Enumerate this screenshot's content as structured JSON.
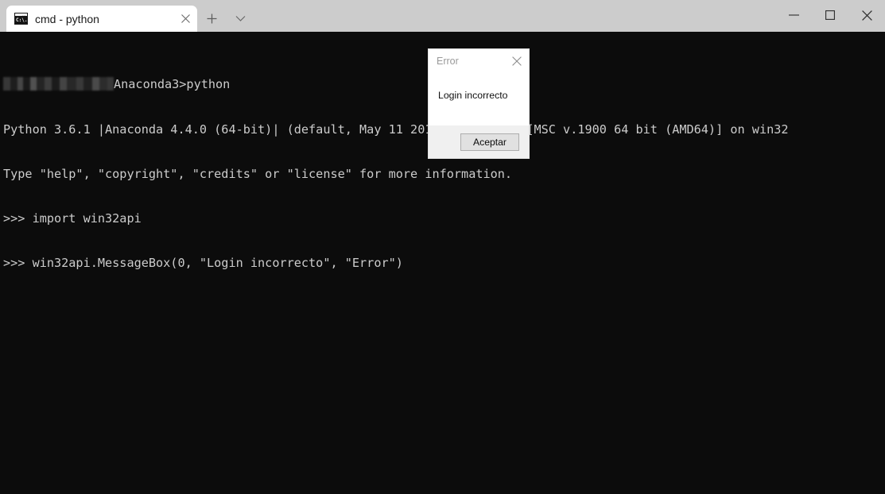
{
  "window": {
    "tabs": [
      {
        "label": "cmd - python",
        "icon": "console-icon",
        "icon_text": "C:\\.",
        "close_icon": "close-icon"
      }
    ],
    "new_tab_icon": "plus-icon",
    "tab_dropdown_icon": "chevron-down-icon",
    "controls": {
      "minimize_icon": "minimize-icon",
      "maximize_icon": "maximize-icon",
      "close_icon": "close-icon"
    }
  },
  "terminal": {
    "background_color": "#0c0c0c",
    "text_color": "#cccccc",
    "lines": [
      {
        "redacted_prefix": true,
        "text": "Anaconda3>python"
      },
      {
        "redacted_prefix": false,
        "text": "Python 3.6.1 |Anaconda 4.4.0 (64-bit)| (default, May 11 2017, 13:25:24) [MSC v.1900 64 bit (AMD64)] on win32"
      },
      {
        "redacted_prefix": false,
        "text": "Type \"help\", \"copyright\", \"credits\" or \"license\" for more information."
      },
      {
        "redacted_prefix": false,
        "text": ">>> import win32api"
      },
      {
        "redacted_prefix": false,
        "text": ">>> win32api.MessageBox(0, \"Login incorrecto\", \"Error\")"
      }
    ]
  },
  "dialog": {
    "title": "Error",
    "close_icon": "close-icon",
    "message": "Login incorrecto",
    "button_label": "Aceptar"
  }
}
